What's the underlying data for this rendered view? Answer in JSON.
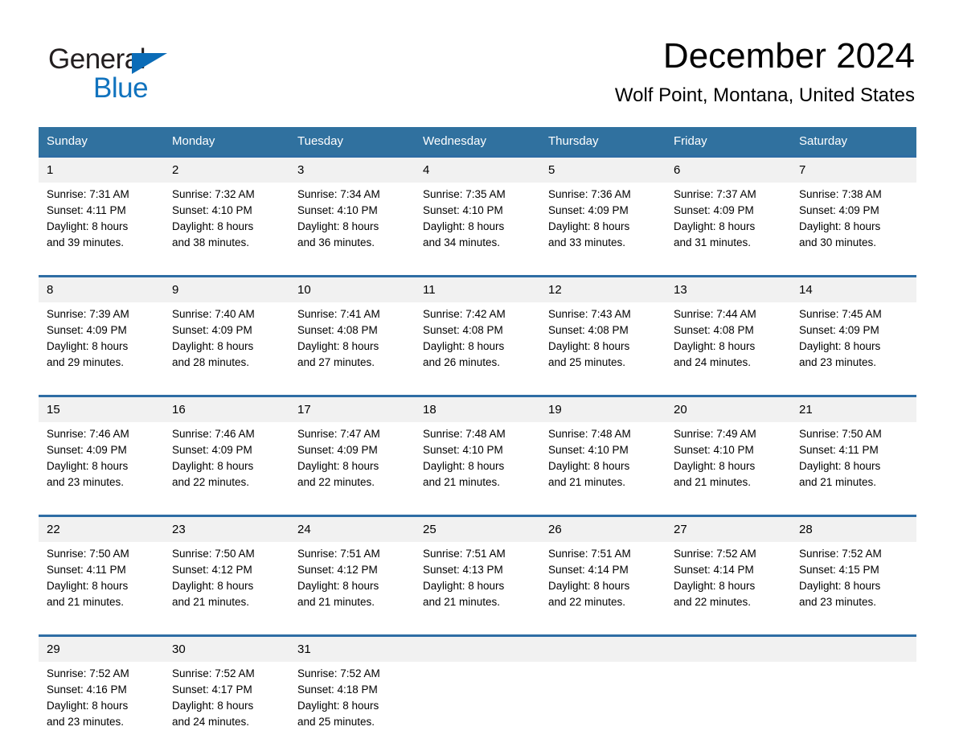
{
  "brand": {
    "word_one": "General",
    "word_two": "Blue",
    "triangle_icon": "triangle-icon",
    "accent_color": "#1173be"
  },
  "header": {
    "title": "December 2024",
    "subtitle": "Wolf Point, Montana, United States"
  },
  "theme": {
    "header_blue": "#30719f",
    "rule_blue": "#2e6da4",
    "daynum_band": "#f1f1f1",
    "text": "#000000"
  },
  "calendar": {
    "weekday_headers": [
      "Sunday",
      "Monday",
      "Tuesday",
      "Wednesday",
      "Thursday",
      "Friday",
      "Saturday"
    ],
    "weeks": [
      [
        {
          "day": "1",
          "sunrise": "Sunrise: 7:31 AM",
          "sunset": "Sunset: 4:11 PM",
          "daylight_1": "Daylight: 8 hours",
          "daylight_2": "and 39 minutes."
        },
        {
          "day": "2",
          "sunrise": "Sunrise: 7:32 AM",
          "sunset": "Sunset: 4:10 PM",
          "daylight_1": "Daylight: 8 hours",
          "daylight_2": "and 38 minutes."
        },
        {
          "day": "3",
          "sunrise": "Sunrise: 7:34 AM",
          "sunset": "Sunset: 4:10 PM",
          "daylight_1": "Daylight: 8 hours",
          "daylight_2": "and 36 minutes."
        },
        {
          "day": "4",
          "sunrise": "Sunrise: 7:35 AM",
          "sunset": "Sunset: 4:10 PM",
          "daylight_1": "Daylight: 8 hours",
          "daylight_2": "and 34 minutes."
        },
        {
          "day": "5",
          "sunrise": "Sunrise: 7:36 AM",
          "sunset": "Sunset: 4:09 PM",
          "daylight_1": "Daylight: 8 hours",
          "daylight_2": "and 33 minutes."
        },
        {
          "day": "6",
          "sunrise": "Sunrise: 7:37 AM",
          "sunset": "Sunset: 4:09 PM",
          "daylight_1": "Daylight: 8 hours",
          "daylight_2": "and 31 minutes."
        },
        {
          "day": "7",
          "sunrise": "Sunrise: 7:38 AM",
          "sunset": "Sunset: 4:09 PM",
          "daylight_1": "Daylight: 8 hours",
          "daylight_2": "and 30 minutes."
        }
      ],
      [
        {
          "day": "8",
          "sunrise": "Sunrise: 7:39 AM",
          "sunset": "Sunset: 4:09 PM",
          "daylight_1": "Daylight: 8 hours",
          "daylight_2": "and 29 minutes."
        },
        {
          "day": "9",
          "sunrise": "Sunrise: 7:40 AM",
          "sunset": "Sunset: 4:09 PM",
          "daylight_1": "Daylight: 8 hours",
          "daylight_2": "and 28 minutes."
        },
        {
          "day": "10",
          "sunrise": "Sunrise: 7:41 AM",
          "sunset": "Sunset: 4:08 PM",
          "daylight_1": "Daylight: 8 hours",
          "daylight_2": "and 27 minutes."
        },
        {
          "day": "11",
          "sunrise": "Sunrise: 7:42 AM",
          "sunset": "Sunset: 4:08 PM",
          "daylight_1": "Daylight: 8 hours",
          "daylight_2": "and 26 minutes."
        },
        {
          "day": "12",
          "sunrise": "Sunrise: 7:43 AM",
          "sunset": "Sunset: 4:08 PM",
          "daylight_1": "Daylight: 8 hours",
          "daylight_2": "and 25 minutes."
        },
        {
          "day": "13",
          "sunrise": "Sunrise: 7:44 AM",
          "sunset": "Sunset: 4:08 PM",
          "daylight_1": "Daylight: 8 hours",
          "daylight_2": "and 24 minutes."
        },
        {
          "day": "14",
          "sunrise": "Sunrise: 7:45 AM",
          "sunset": "Sunset: 4:09 PM",
          "daylight_1": "Daylight: 8 hours",
          "daylight_2": "and 23 minutes."
        }
      ],
      [
        {
          "day": "15",
          "sunrise": "Sunrise: 7:46 AM",
          "sunset": "Sunset: 4:09 PM",
          "daylight_1": "Daylight: 8 hours",
          "daylight_2": "and 23 minutes."
        },
        {
          "day": "16",
          "sunrise": "Sunrise: 7:46 AM",
          "sunset": "Sunset: 4:09 PM",
          "daylight_1": "Daylight: 8 hours",
          "daylight_2": "and 22 minutes."
        },
        {
          "day": "17",
          "sunrise": "Sunrise: 7:47 AM",
          "sunset": "Sunset: 4:09 PM",
          "daylight_1": "Daylight: 8 hours",
          "daylight_2": "and 22 minutes."
        },
        {
          "day": "18",
          "sunrise": "Sunrise: 7:48 AM",
          "sunset": "Sunset: 4:10 PM",
          "daylight_1": "Daylight: 8 hours",
          "daylight_2": "and 21 minutes."
        },
        {
          "day": "19",
          "sunrise": "Sunrise: 7:48 AM",
          "sunset": "Sunset: 4:10 PM",
          "daylight_1": "Daylight: 8 hours",
          "daylight_2": "and 21 minutes."
        },
        {
          "day": "20",
          "sunrise": "Sunrise: 7:49 AM",
          "sunset": "Sunset: 4:10 PM",
          "daylight_1": "Daylight: 8 hours",
          "daylight_2": "and 21 minutes."
        },
        {
          "day": "21",
          "sunrise": "Sunrise: 7:50 AM",
          "sunset": "Sunset: 4:11 PM",
          "daylight_1": "Daylight: 8 hours",
          "daylight_2": "and 21 minutes."
        }
      ],
      [
        {
          "day": "22",
          "sunrise": "Sunrise: 7:50 AM",
          "sunset": "Sunset: 4:11 PM",
          "daylight_1": "Daylight: 8 hours",
          "daylight_2": "and 21 minutes."
        },
        {
          "day": "23",
          "sunrise": "Sunrise: 7:50 AM",
          "sunset": "Sunset: 4:12 PM",
          "daylight_1": "Daylight: 8 hours",
          "daylight_2": "and 21 minutes."
        },
        {
          "day": "24",
          "sunrise": "Sunrise: 7:51 AM",
          "sunset": "Sunset: 4:12 PM",
          "daylight_1": "Daylight: 8 hours",
          "daylight_2": "and 21 minutes."
        },
        {
          "day": "25",
          "sunrise": "Sunrise: 7:51 AM",
          "sunset": "Sunset: 4:13 PM",
          "daylight_1": "Daylight: 8 hours",
          "daylight_2": "and 21 minutes."
        },
        {
          "day": "26",
          "sunrise": "Sunrise: 7:51 AM",
          "sunset": "Sunset: 4:14 PM",
          "daylight_1": "Daylight: 8 hours",
          "daylight_2": "and 22 minutes."
        },
        {
          "day": "27",
          "sunrise": "Sunrise: 7:52 AM",
          "sunset": "Sunset: 4:14 PM",
          "daylight_1": "Daylight: 8 hours",
          "daylight_2": "and 22 minutes."
        },
        {
          "day": "28",
          "sunrise": "Sunrise: 7:52 AM",
          "sunset": "Sunset: 4:15 PM",
          "daylight_1": "Daylight: 8 hours",
          "daylight_2": "and 23 minutes."
        }
      ],
      [
        {
          "day": "29",
          "sunrise": "Sunrise: 7:52 AM",
          "sunset": "Sunset: 4:16 PM",
          "daylight_1": "Daylight: 8 hours",
          "daylight_2": "and 23 minutes."
        },
        {
          "day": "30",
          "sunrise": "Sunrise: 7:52 AM",
          "sunset": "Sunset: 4:17 PM",
          "daylight_1": "Daylight: 8 hours",
          "daylight_2": "and 24 minutes."
        },
        {
          "day": "31",
          "sunrise": "Sunrise: 7:52 AM",
          "sunset": "Sunset: 4:18 PM",
          "daylight_1": "Daylight: 8 hours",
          "daylight_2": "and 25 minutes."
        },
        {
          "day": "",
          "sunrise": "",
          "sunset": "",
          "daylight_1": "",
          "daylight_2": ""
        },
        {
          "day": "",
          "sunrise": "",
          "sunset": "",
          "daylight_1": "",
          "daylight_2": ""
        },
        {
          "day": "",
          "sunrise": "",
          "sunset": "",
          "daylight_1": "",
          "daylight_2": ""
        },
        {
          "day": "",
          "sunrise": "",
          "sunset": "",
          "daylight_1": "",
          "daylight_2": ""
        }
      ]
    ]
  }
}
